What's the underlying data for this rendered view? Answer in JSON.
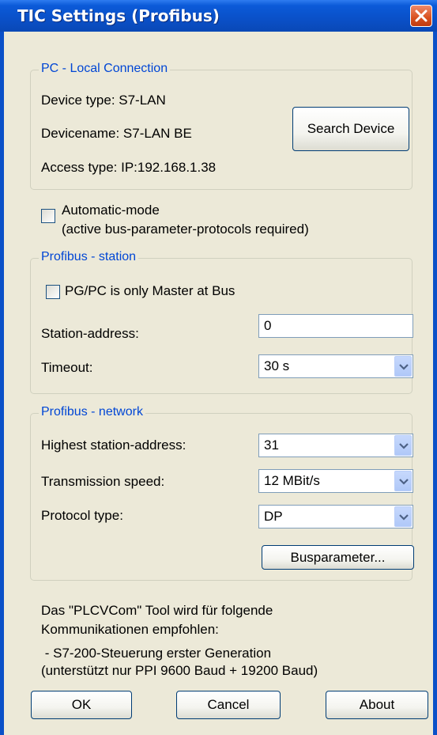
{
  "window": {
    "title": "TIC Settings (Profibus)"
  },
  "pc_local": {
    "legend": "PC - Local Connection",
    "device_type": "Device type:  S7-LAN",
    "device_name": "Devicename: S7-LAN BE",
    "access_type": "Access type:  IP:192.168.1.38",
    "search_button": "Search Device"
  },
  "automatic_mode": {
    "checked": false,
    "line1": "Automatic-mode",
    "line2": "(active bus-parameter-protocols required)"
  },
  "station": {
    "legend": "Profibus - station",
    "only_master_label": "PG/PC is only Master at Bus",
    "only_master_checked": false,
    "address_label": "Station-address:",
    "address_value": "0",
    "timeout_label": "Timeout:",
    "timeout_value": "30 s"
  },
  "network": {
    "legend": "Profibus - network",
    "highest_label": "Highest station-address:",
    "highest_value": "31",
    "speed_label": "Transmission speed:",
    "speed_value": "12 MBit/s",
    "protocol_label": "Protocol type:",
    "protocol_value": "DP",
    "busparam_button": "Busparameter..."
  },
  "info": {
    "line1": "Das \"PLCVCom\" Tool wird für folgende",
    "line2": "Kommunikationen empfohlen:",
    "line3": " - S7-200-Steuerung erster Generation",
    "line4": "(unterstützt nur PPI 9600 Baud + 19200 Baud)"
  },
  "buttons": {
    "ok": "OK",
    "cancel": "Cancel",
    "about": "About"
  }
}
